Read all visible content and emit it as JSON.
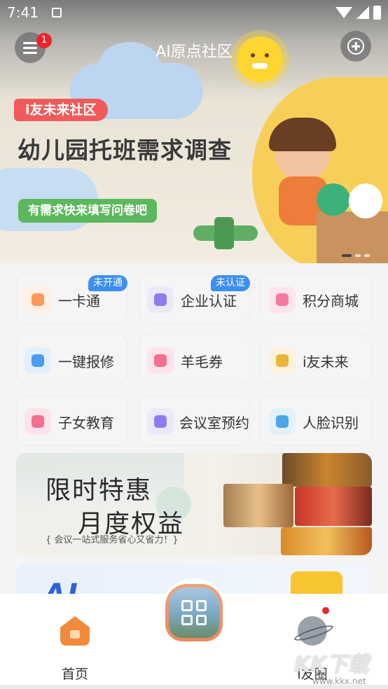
{
  "status_bar": {
    "time": "7:41"
  },
  "header": {
    "title": "AI原点社区",
    "notification_count": "1"
  },
  "hero": {
    "tag": "i友未来社区",
    "headline": "幼儿园托班需求调查",
    "cta": "有需求快来填写问卷吧",
    "slides_total": 3,
    "active_slide": 1
  },
  "services": [
    {
      "label": "一卡通",
      "badge": "未开通",
      "icon": "card-icon",
      "color": "#ff9a5a",
      "bg": "#fff0e5"
    },
    {
      "label": "企业认证",
      "badge": "未认证",
      "icon": "enterprise-icon",
      "color": "#8b7cf0",
      "bg": "#ece9fb"
    },
    {
      "label": "积分商城",
      "badge": "",
      "icon": "shop-bag-icon",
      "color": "#f57aa0",
      "bg": "#fde5ee"
    },
    {
      "label": "一键报修",
      "badge": "",
      "icon": "repair-tools-icon",
      "color": "#4a9df0",
      "bg": "#e2effc"
    },
    {
      "label": "羊毛券",
      "badge": "",
      "icon": "coupon-icon",
      "color": "#f26f8f",
      "bg": "#fde3ea"
    },
    {
      "label": "i友未来",
      "badge": "",
      "icon": "ai-logo-icon",
      "color": "#e9b53a",
      "bg": "#fdf2dc"
    },
    {
      "label": "子女教育",
      "badge": "",
      "icon": "graduation-cap-icon",
      "color": "#f26f8f",
      "bg": "#fde3ea"
    },
    {
      "label": "会议室预约",
      "badge": "",
      "icon": "meeting-board-icon",
      "color": "#8b7cf0",
      "bg": "#ece9fb"
    },
    {
      "label": "人脸识别",
      "badge": "",
      "icon": "face-scan-icon",
      "color": "#4aa7e8",
      "bg": "#e2f1fc"
    }
  ],
  "promo": {
    "line1": "限时特惠",
    "line2": "月度权益",
    "line3": "{ 会议一站式服务省心又省力！}"
  },
  "promo2": {
    "text": "AI"
  },
  "tabbar": {
    "home": "首页",
    "circle": "i友圈"
  },
  "watermark": {
    "brand": "KK下载",
    "url": "www.kkx.net"
  }
}
